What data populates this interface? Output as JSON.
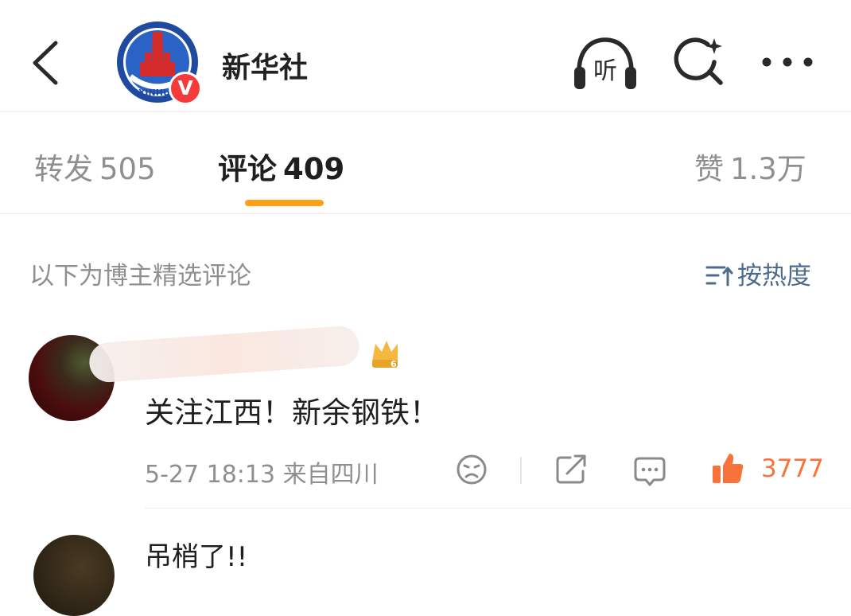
{
  "header": {
    "title": "新华社",
    "avatar_lettering": "XINHUA",
    "verified_mark": "V",
    "listen_label": "听"
  },
  "tabs": [
    {
      "label": "转发",
      "count": "505"
    },
    {
      "label": "评论",
      "count": "409"
    },
    {
      "label": "赞",
      "count": "1.3万"
    }
  ],
  "section": {
    "label": "以下为博主精选评论",
    "sort_label": "按热度"
  },
  "comments": [
    {
      "badge_level": "6",
      "text": "关注江西！新余钢铁！",
      "timestamp": "5-27 18:13",
      "source": "来自四川",
      "likes": "3777"
    },
    {
      "text": "吊梢了!!"
    }
  ],
  "colors": {
    "accent": "#ff9f1a",
    "like": "#f7733b",
    "link": "#4d6b8c",
    "badge_red": "#f53a3a"
  },
  "icons": [
    "back-arrow-icon",
    "listen-headphones-icon",
    "search-sparkle-icon",
    "more-icon",
    "sort-icon",
    "sad-face-icon",
    "share-icon",
    "comment-icon",
    "thumbs-up-icon"
  ]
}
